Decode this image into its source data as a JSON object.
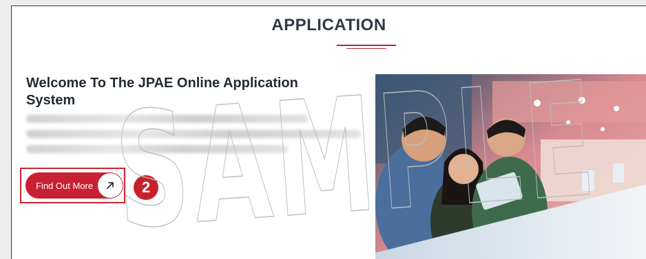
{
  "section": {
    "heading": "APPLICATION",
    "accent_color": "#b7243a"
  },
  "intro": {
    "title": "Welcome To The JPAE Online Application System"
  },
  "cta": {
    "label": "Find Out More",
    "icon": "arrow-up-right-icon",
    "color": "#c92034"
  },
  "annotation": {
    "step": "2",
    "color": "#d0222e"
  },
  "watermark": {
    "text": "SAMPLE"
  },
  "image": {
    "subject": "students-at-counter-photo"
  }
}
